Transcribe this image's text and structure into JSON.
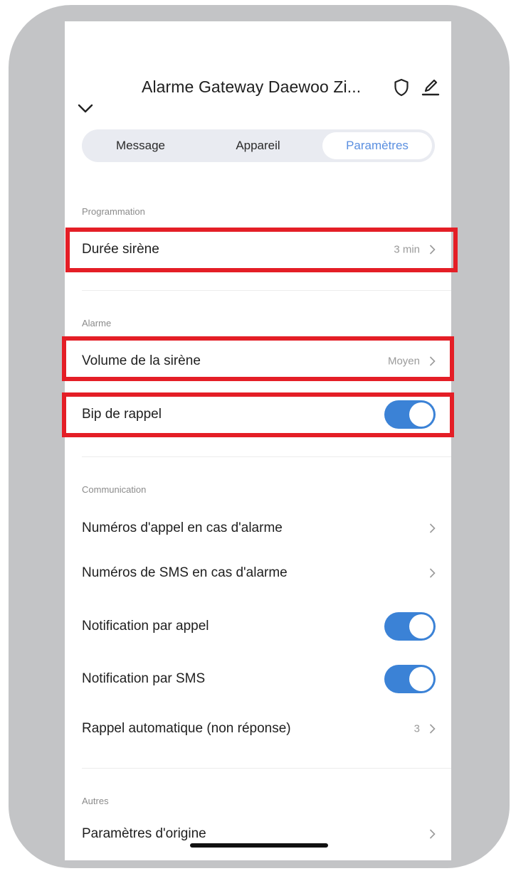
{
  "header": {
    "title": "Alarme Gateway Daewoo Zi...",
    "back_icon": "chevron-down-icon",
    "shield_icon": "shield-icon",
    "edit_icon": "pencil-icon"
  },
  "tabs": [
    {
      "label": "Message",
      "active": false
    },
    {
      "label": "Appareil",
      "active": false
    },
    {
      "label": "Paramètres",
      "active": true
    }
  ],
  "sections": {
    "programmation": {
      "label": "Programmation",
      "rows": [
        {
          "label": "Durée sirène",
          "value": "3 min"
        }
      ]
    },
    "alarme": {
      "label": "Alarme",
      "rows": [
        {
          "label": "Volume de la sirène",
          "value": "Moyen"
        },
        {
          "label": "Bip de rappel",
          "toggle": true
        }
      ]
    },
    "communication": {
      "label": "Communication",
      "rows": [
        {
          "label": "Numéros d'appel en cas d'alarme"
        },
        {
          "label": "Numéros de SMS en cas d'alarme"
        },
        {
          "label": "Notification par appel",
          "toggle": true
        },
        {
          "label": "Notification par SMS",
          "toggle": true
        },
        {
          "label": "Rappel automatique (non réponse)",
          "value": "3"
        }
      ]
    },
    "autres": {
      "label": "Autres",
      "rows": [
        {
          "label": "Paramètres d'origine"
        }
      ]
    }
  },
  "colors": {
    "accent": "#3b82d6",
    "active_tab_text": "#5a8fe0",
    "highlight_border": "#e41e26",
    "frame": "#c3c4c6"
  }
}
